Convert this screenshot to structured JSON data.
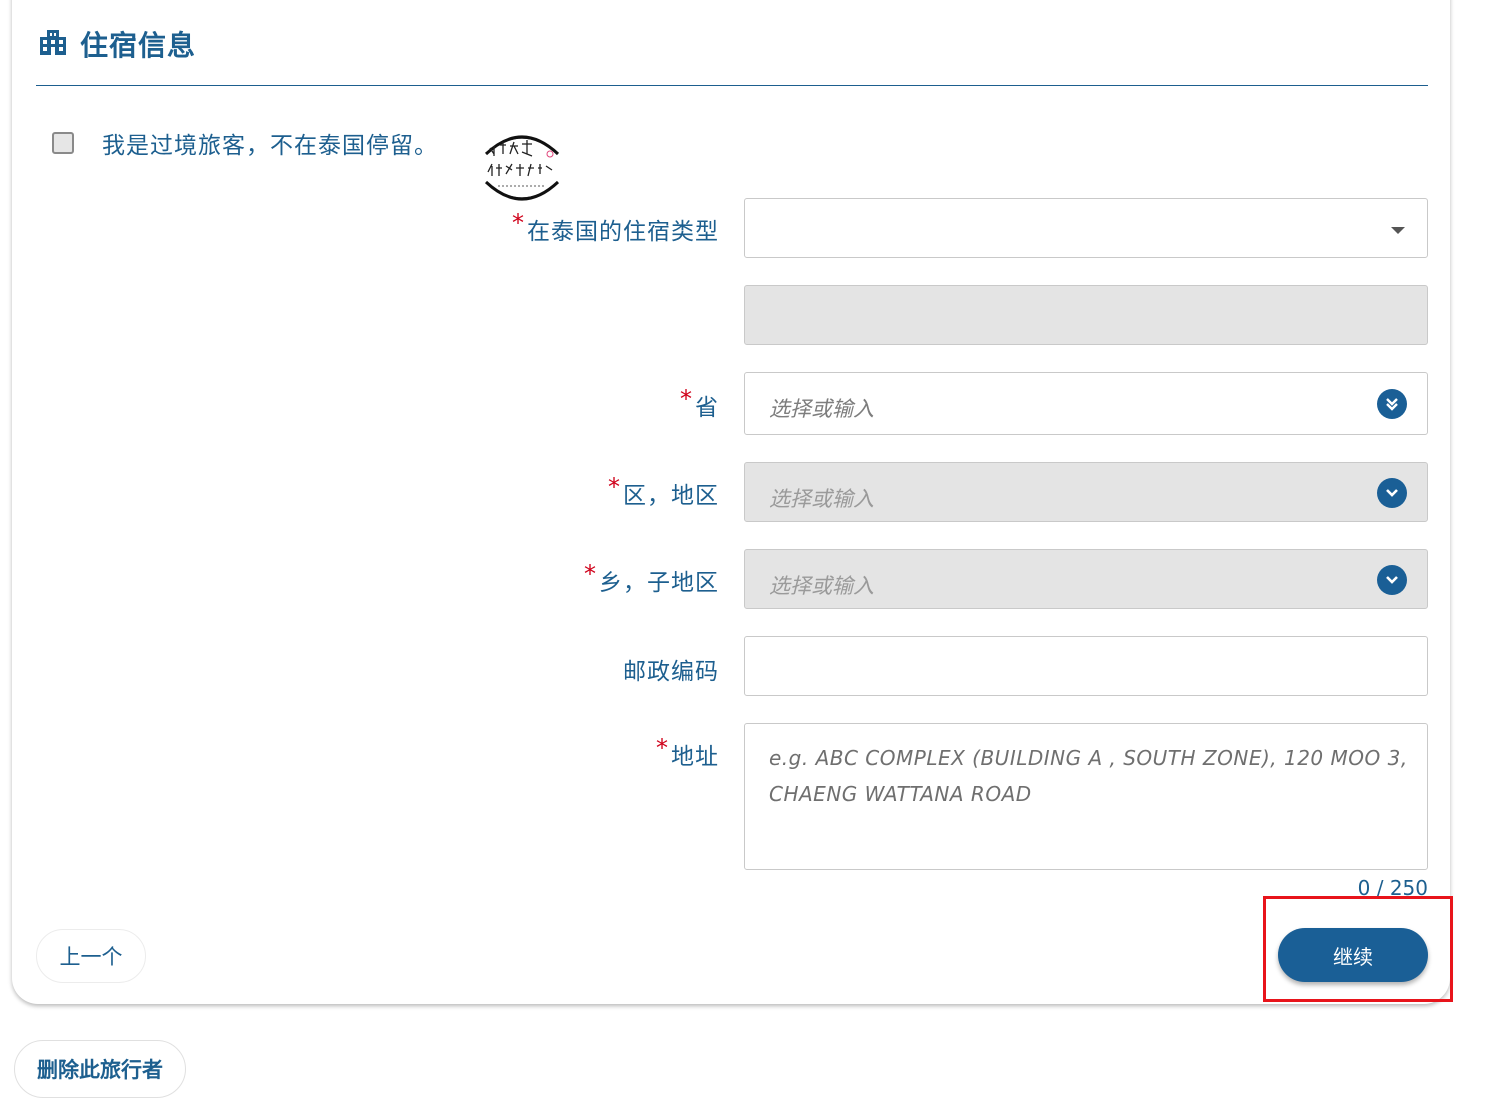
{
  "section": {
    "title": "住宿信息",
    "icon": "building-icon"
  },
  "transit": {
    "label": "我是过境旅客，不在泰国停留。",
    "checked": false
  },
  "stamp": {
    "icon": "stamp-logo"
  },
  "form": {
    "required_mark": "*",
    "accommodation_type": {
      "label": "在泰国的住宿类型",
      "value": ""
    },
    "accommodation_name": {
      "value": ""
    },
    "province": {
      "label": "省",
      "placeholder": "选择或输入"
    },
    "district": {
      "label": "区，地区",
      "placeholder": "选择或输入"
    },
    "subdistrict": {
      "label": "乡，子地区",
      "placeholder": "选择或输入"
    },
    "postal_code": {
      "label": "邮政编码",
      "value": ""
    },
    "address": {
      "label": "地址",
      "placeholder": "e.g. ABC COMPLEX (BUILDING A , SOUTH ZONE), 120 MOO 3, CHAENG WATTANA ROAD",
      "counter": "0 / 250"
    }
  },
  "buttons": {
    "previous": "上一个",
    "continue": "继续",
    "delete_traveler": "删除此旅行者"
  },
  "colors": {
    "primary": "#1a5f96",
    "text": "#1d5f8f",
    "required": "#d0021b",
    "highlight": "#e8141b"
  }
}
